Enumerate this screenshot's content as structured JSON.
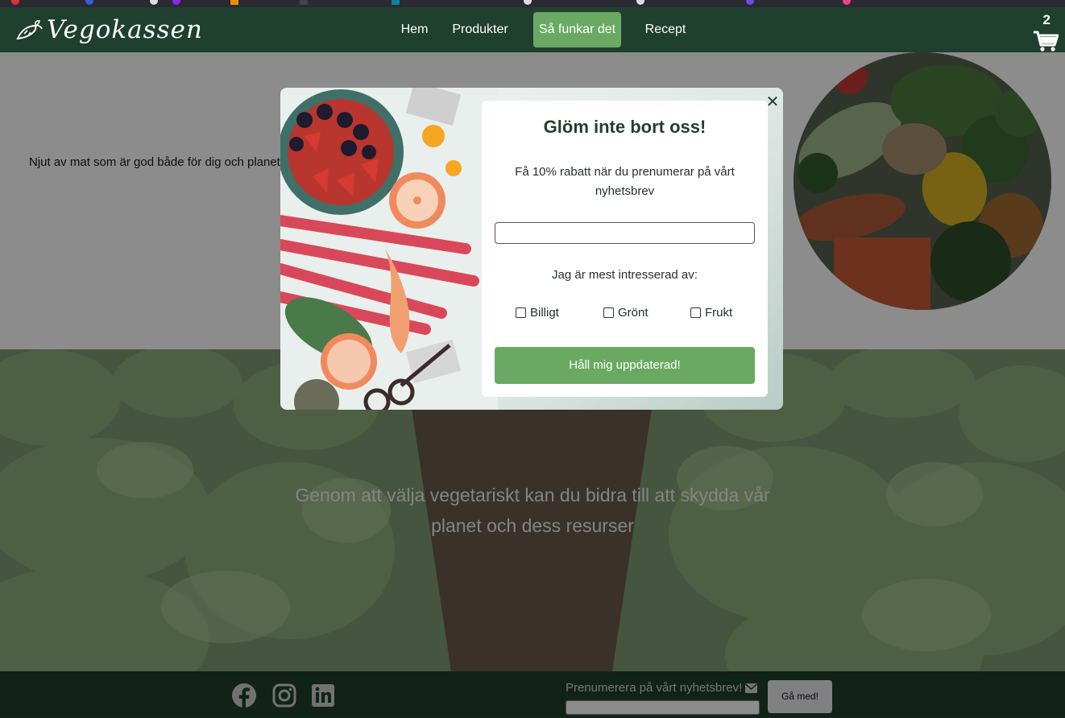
{
  "colors": {
    "nav_bg": "#1f3f2f",
    "accent_green": "#6aa962",
    "overlay": "rgba(0,0,0,0.45)"
  },
  "brand": {
    "name": "Vegokassen",
    "icon": "carrot-icon"
  },
  "nav": {
    "links": [
      {
        "label": "Hem"
      },
      {
        "label": "Produkter"
      },
      {
        "label": "Så funkar det",
        "active": true
      },
      {
        "label": "Recept"
      }
    ]
  },
  "cart": {
    "count": "2",
    "icon": "cart-icon"
  },
  "hero": {
    "text": "Njut av mat som är god både för dig och planeten"
  },
  "field": {
    "quote_line1": "Genom att välja vegetariskt kan du bidra till att skydda vår",
    "quote_line2": "planet och dess resurser"
  },
  "modal": {
    "title": "Glöm inte bort oss!",
    "description": "Få 10% rabatt när du prenumerar på vårt nyhetsbrev",
    "email_value": "",
    "interest_label": "Jag är mest intresserad av:",
    "options": [
      {
        "label": "Billigt",
        "checked": false
      },
      {
        "label": "Grönt",
        "checked": false
      },
      {
        "label": "Frukt",
        "checked": false
      }
    ],
    "submit_label": "Håll mig uppdaterad!",
    "close_icon": "close-icon"
  },
  "footer": {
    "social_icons": [
      "facebook-icon",
      "instagram-icon",
      "linkedin-icon"
    ],
    "subscribe_label": "Prenumerera på vårt nyhetsbrev!",
    "subscribe_input_value": "",
    "join_button": "Gå med!"
  }
}
